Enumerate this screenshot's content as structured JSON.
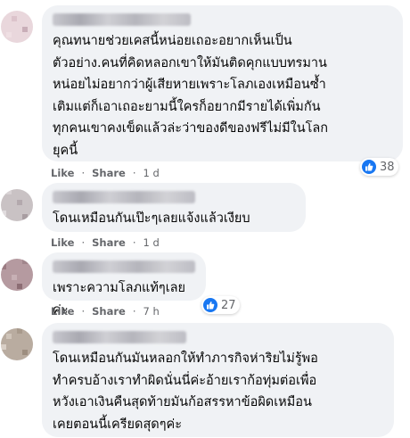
{
  "comments": [
    {
      "text": "คุณทนายช่วยเคสนี้หน่อยเถอะอยากเห็นเป็น\nตัวอย่าง.คนที่คิดหลอกเขาให้มันติดคุกแบบทรมาน\nหน่อยไม่อยากว่าผู้เสียหายเพราะโลภเองเหมือนซ้ำ\nเติมแต่ก็เอาเถอะยามนี้ใครก็อยากมีรายได้เพิ่มกัน\nทุกคนเขาคงเข็ดแล้วล่ะว่าของดีของฟรีไม่มีในโลก\nยุคนี้",
      "like_label": "Like",
      "share_label": "Share",
      "time": "1 d",
      "reaction_count": "38"
    },
    {
      "text": "โดนเหมือนกันเป๊ะๆเลยแจ้งแล้วเงียบ",
      "like_label": "Like",
      "share_label": "Share",
      "time": "1 d"
    },
    {
      "text": "เพราะความโลภแท้ๆเลยค่ะ",
      "like_label": "Like",
      "share_label": "Share",
      "time": "7 h",
      "reaction_count": "27"
    },
    {
      "text": "โดนเหมือนกันมันหลอกให้ทำภารกิจห่าริยไม่รู้พอ\nทำครบอ้างเราทำผิดนั่นนี่ค่ะอ้ายเราก้อทุ่มต่อเพื่อ\nหวังเอาเงินคืนสุดท้ายมันก้อสรรหาข้อผิดเหมือน\nเคยตอนนี้เครียดสุดๆค่ะ"
    }
  ],
  "separator": "·",
  "colors": {
    "bubble": "#f0f2f5",
    "like_blue": "#1877f2",
    "meta": "#65676b"
  }
}
